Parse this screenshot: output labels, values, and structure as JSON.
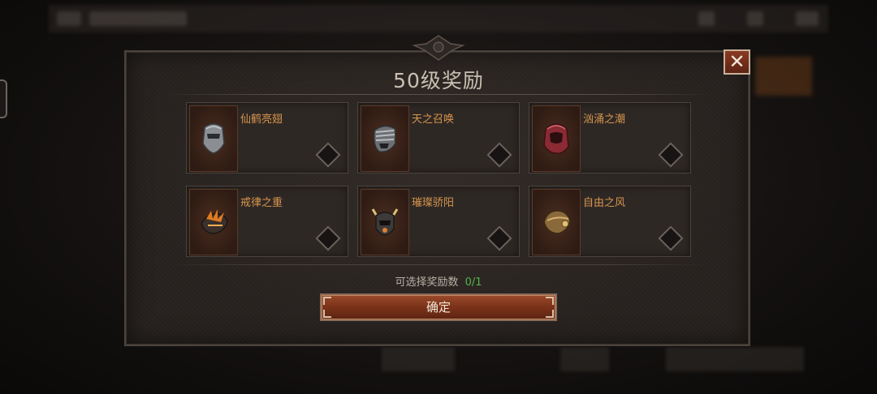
{
  "dialog": {
    "title": "50级奖励",
    "close_icon": "close-x-icon",
    "rewards": [
      {
        "name": "仙鹤亮翅",
        "icon": "silver-helmet-icon"
      },
      {
        "name": "天之召唤",
        "icon": "striped-helmet-icon"
      },
      {
        "name": "汹涌之潮",
        "icon": "crimson-hood-icon"
      },
      {
        "name": "戒律之重",
        "icon": "flame-gauntlet-icon"
      },
      {
        "name": "璀璨骄阳",
        "icon": "horned-helmet-icon"
      },
      {
        "name": "自由之风",
        "icon": "bronze-helmet-icon"
      }
    ],
    "selectable_label": "可选择奖励数",
    "selectable_count": "0/1",
    "confirm_label": "确定"
  },
  "colors": {
    "accent_orange": "#d7954c",
    "count_green": "#54b34a",
    "button_red": "#7a3219"
  }
}
